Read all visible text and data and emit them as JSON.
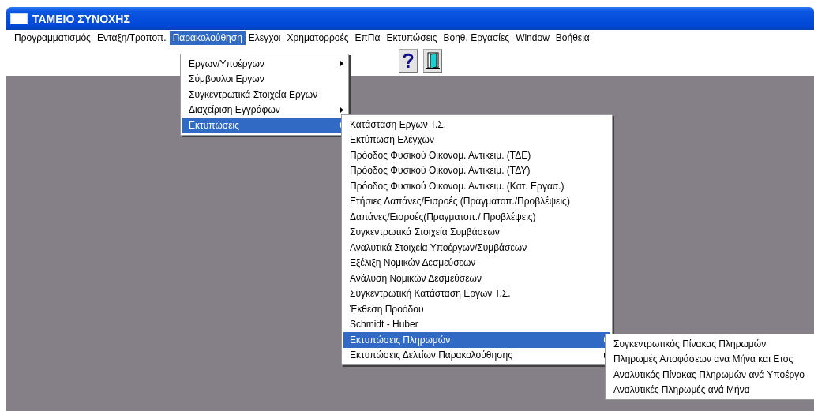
{
  "window": {
    "title": "ΤΑΜΕΙΟ ΣΥΝΟΧΗΣ"
  },
  "menu_bar": [
    {
      "label": "Προγραμματισμός",
      "selected": false
    },
    {
      "label": "Ενταξη/Τροποπ.",
      "selected": false
    },
    {
      "label": "Παρακολούθηση",
      "selected": true
    },
    {
      "label": "Ελεγχοι",
      "selected": false
    },
    {
      "label": "Χρηματορροές",
      "selected": false
    },
    {
      "label": "ΕπΠα",
      "selected": false
    },
    {
      "label": "Εκτυπώσεις",
      "selected": false
    },
    {
      "label": "Βοηθ. Εργασίες",
      "selected": false
    },
    {
      "label": "Window",
      "selected": false
    },
    {
      "label": "Βοήθεια",
      "selected": false
    }
  ],
  "toolbar": [
    {
      "kind": "help"
    },
    {
      "kind": "exit"
    }
  ],
  "menus": [
    {
      "items": [
        {
          "label": "Εργων/Υποέργων",
          "submenu": true,
          "selected": false
        },
        {
          "label": "Σύμβουλοι Εργων",
          "submenu": false,
          "selected": false
        },
        {
          "label": "Συγκεντρωτικά Στοιχεία Εργων",
          "submenu": false,
          "selected": false
        },
        {
          "label": "Διαχείριση Εγγράφων",
          "submenu": true,
          "selected": false
        },
        {
          "label": "Εκτυπώσεις",
          "submenu": true,
          "selected": true
        }
      ]
    },
    {
      "items": [
        {
          "label": "Κατάσταση Εργων Τ.Σ.",
          "submenu": false,
          "selected": false
        },
        {
          "label": "Εκτύπωση Ελέγχων",
          "submenu": false,
          "selected": false
        },
        {
          "label": "Πρόοδος Φυσικού Οικονομ. Αντικειμ. (ΤΔΕ)",
          "submenu": false,
          "selected": false
        },
        {
          "label": "Πρόοδος Φυσικού Οικονομ. Αντικειμ. (ΤΔΥ)",
          "submenu": false,
          "selected": false
        },
        {
          "label": "Πρόοδος Φυσικού Οικονομ. Αντικειμ. (Κατ. Εργασ.)",
          "submenu": false,
          "selected": false
        },
        {
          "label": "Ετήσιες Δαπάνες/Εισροές (Πραγματοπ./Προβλέψεις)",
          "submenu": false,
          "selected": false
        },
        {
          "label": "Δαπάνες/Εισροές(Πραγματοπ./ Προβλέψεις)",
          "submenu": false,
          "selected": false
        },
        {
          "label": "Συγκεντρωτικά Στοιχεία Συμβάσεων",
          "submenu": false,
          "selected": false
        },
        {
          "label": "Αναλυτικά Στοιχεία Υποέργων/Συμβάσεων",
          "submenu": false,
          "selected": false
        },
        {
          "label": "Εξέλιξη Νομικών Δεσμεύσεων",
          "submenu": false,
          "selected": false
        },
        {
          "label": "Ανάλυση Νομικών Δεσμεύσεων",
          "submenu": false,
          "selected": false
        },
        {
          "label": "Συγκεντρωτική Κατάσταση Εργων Τ.Σ.",
          "submenu": false,
          "selected": false
        },
        {
          "label": "Έκθεση Προόδου",
          "submenu": false,
          "selected": false
        },
        {
          "label": "Schmidt - Huber",
          "submenu": false,
          "selected": false
        },
        {
          "label": "Εκτυπώσεις Πληρωμών",
          "submenu": true,
          "selected": true
        },
        {
          "label": "Εκτυπώσεις Δελτίων Παρακολούθησης",
          "submenu": true,
          "selected": false
        }
      ]
    },
    {
      "items": [
        {
          "label": "Συγκεντρωτικός Πίνακας Πληρωμών",
          "submenu": false,
          "selected": false
        },
        {
          "label": "Πληρωμές Αποφάσεων ανα Μήνα και Ετος",
          "submenu": false,
          "selected": false
        },
        {
          "label": "Αναλυτικός Πίνακας Πληρωμών ανά Υποέργο",
          "submenu": false,
          "selected": false
        },
        {
          "label": "Αναλυτικές Πληρωμές ανά Μήνα",
          "submenu": false,
          "selected": false
        }
      ]
    }
  ]
}
